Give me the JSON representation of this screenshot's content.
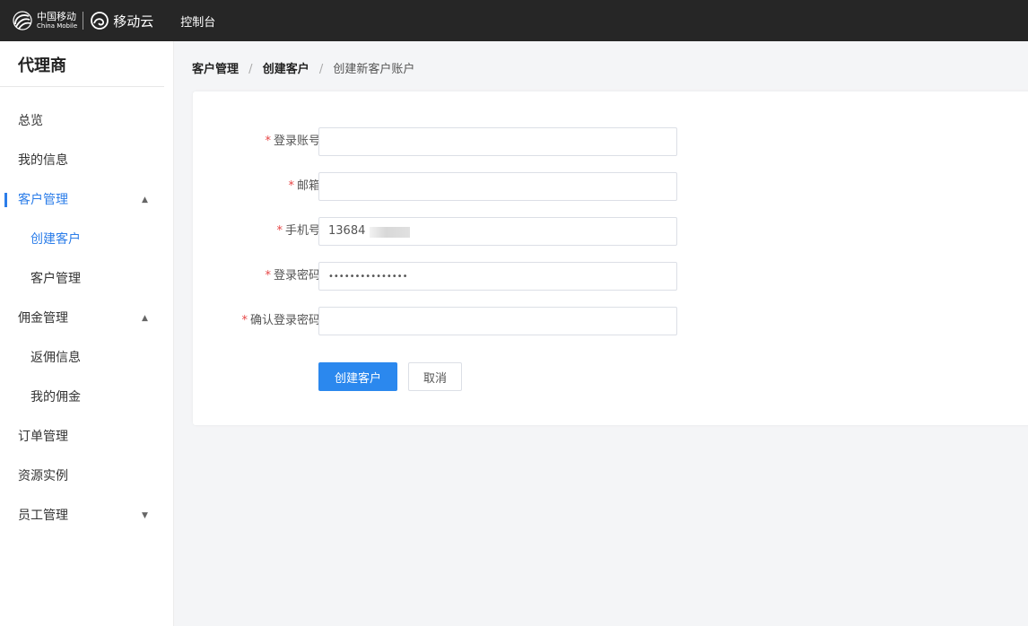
{
  "topbar": {
    "brand_cn": "中国移动",
    "brand_en": "China Mobile",
    "cloud_name": "移动云",
    "nav_console": "控制台",
    "background": "#262626"
  },
  "sidebar": {
    "title": "代理商",
    "items": [
      {
        "label": "总览"
      },
      {
        "label": "我的信息"
      },
      {
        "label": "客户管理",
        "expanded": true,
        "active_parent": true
      },
      {
        "label": "创建客户",
        "sub": true,
        "active": true
      },
      {
        "label": "客户管理",
        "sub": true
      },
      {
        "label": "佣金管理",
        "expanded": true
      },
      {
        "label": "返佣信息",
        "sub": true
      },
      {
        "label": "我的佣金",
        "sub": true
      },
      {
        "label": "订单管理"
      },
      {
        "label": "资源实例"
      },
      {
        "label": "员工管理",
        "expanded": false
      }
    ],
    "caret_up": "▲",
    "caret_down": "▼"
  },
  "breadcrumb": {
    "items": [
      "客户管理",
      "创建客户",
      "创建新客户账户"
    ],
    "separator": "/"
  },
  "form": {
    "required_mark": "*",
    "fields": [
      {
        "label": "登录账号",
        "value": ""
      },
      {
        "label": "邮箱",
        "value": ""
      },
      {
        "label": "手机号",
        "value": "13684"
      },
      {
        "label": "登录密码",
        "value": "•••••••••••••••"
      },
      {
        "label": "确认登录密码",
        "value": ""
      }
    ],
    "submit_label": "创建客户",
    "cancel_label": "取消"
  },
  "colors": {
    "accent": "#2b7de9",
    "primary_button": "#2b88ee",
    "required": "#e64545",
    "page_bg": "#f4f5f7"
  }
}
